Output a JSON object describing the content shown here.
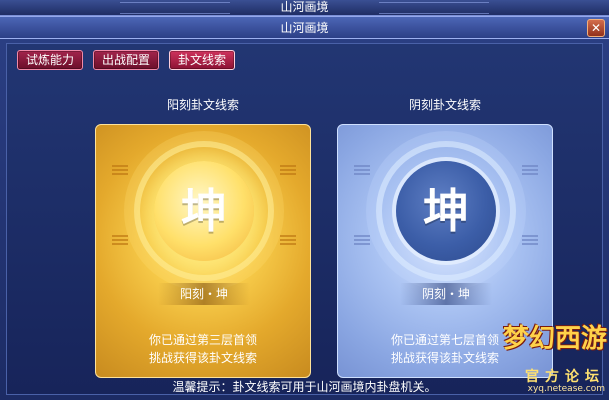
{
  "window": {
    "outer_title": "山河画境",
    "inner_title": "山河画境"
  },
  "tabs": [
    {
      "label": "试炼能力",
      "active": false
    },
    {
      "label": "出战配置",
      "active": false
    },
    {
      "label": "卦文线索",
      "active": true
    }
  ],
  "cards": [
    {
      "heading": "阳刻卦文线索",
      "glyph": "坤",
      "name": "阳刻・坤",
      "desc_line1": "你已通过第三层首领",
      "desc_line2": "挑战获得该卦文线索"
    },
    {
      "heading": "阴刻卦文线索",
      "glyph": "坤",
      "name": "阴刻・坤",
      "desc_line1": "你已通过第七层首领",
      "desc_line2": "挑战获得该卦文线索"
    }
  ],
  "footer": {
    "tip": "温馨提示：卦文线索可用于山河画境内卦盘机关。"
  },
  "watermark": {
    "logo_text": "梦幻西游",
    "forum_text": "官方论坛",
    "url_text": "xyq.netease.com"
  },
  "colors": {
    "tab_bg": "#8c1234",
    "yang_card": "#f7cb4a",
    "yin_card": "#a9c2f2",
    "window_bg": "#223673"
  }
}
